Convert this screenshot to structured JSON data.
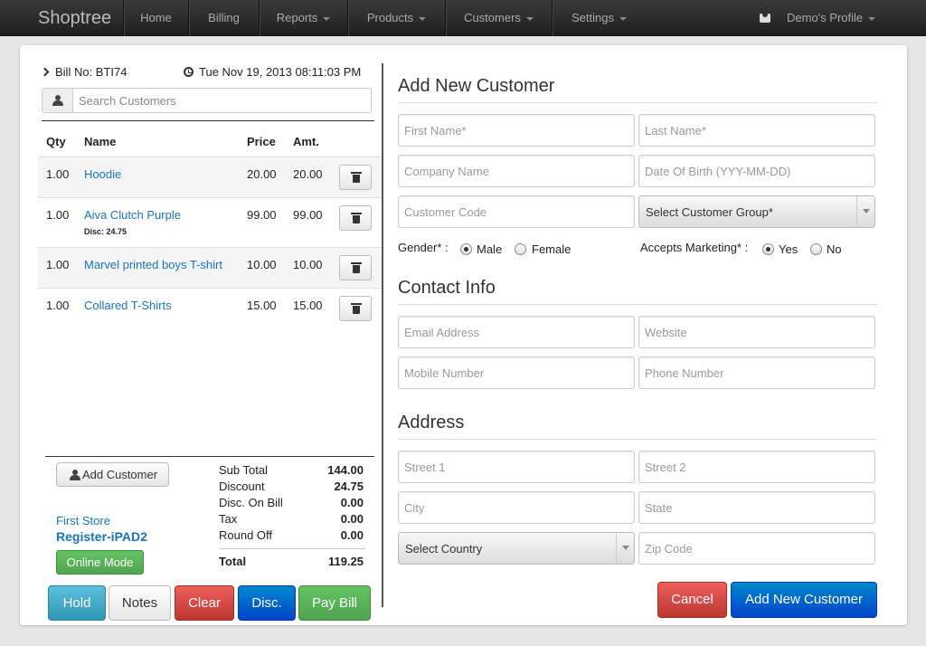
{
  "nav": {
    "brand": "Shoptree",
    "items": [
      "Home",
      "Billing",
      "Reports",
      "Products",
      "Customers",
      "Settings"
    ],
    "profile": "Demo's Profile"
  },
  "bill": {
    "bill_no": "Bill No: BTI74",
    "date": "Tue Nov 19, 2013 08:11:03 PM",
    "search_placeholder": "Search Customers",
    "headers": {
      "qty": "Qty",
      "name": "Name",
      "price": "Price",
      "amt": "Amt."
    },
    "items": [
      {
        "qty": "1.00",
        "name": "Hoodie",
        "price": "20.00",
        "amt": "20.00",
        "disc": ""
      },
      {
        "qty": "1.00",
        "name": "Aiva Clutch Purple",
        "price": "99.00",
        "amt": "99.00",
        "disc": "Disc: 24.75"
      },
      {
        "qty": "1.00",
        "name": "Marvel printed boys T-shirt",
        "price": "10.00",
        "amt": "10.00",
        "disc": ""
      },
      {
        "qty": "1.00",
        "name": "Collared T-Shirts",
        "price": "15.00",
        "amt": "15.00",
        "disc": ""
      }
    ],
    "add_customer": "Add Customer",
    "store": "First Store",
    "register": "Register-iPAD2",
    "online_mode": "Online Mode",
    "summary": [
      {
        "label": "Sub Total",
        "value": "144.00"
      },
      {
        "label": "Discount",
        "value": "24.75"
      },
      {
        "label": "Disc. On Bill",
        "value": "0.00"
      },
      {
        "label": "Tax",
        "value": "0.00"
      },
      {
        "label": "Round Off",
        "value": "0.00"
      }
    ],
    "total_label": "Total",
    "total_value": "119.25",
    "actions": {
      "hold": "Hold",
      "notes": "Notes",
      "clear": "Clear",
      "disc": "Disc.",
      "pay": "Pay Bill"
    }
  },
  "form": {
    "title": "Add New Customer",
    "first_name": "First Name*",
    "last_name": "Last Name*",
    "company": "Company Name",
    "dob": "Date Of Birth (YYY-MM-DD)",
    "customer_code": "Customer Code",
    "customer_group": "Select Customer Group*",
    "gender_label": "Gender* :",
    "gender_male": "Male",
    "gender_female": "Female",
    "marketing_label": "Accepts Marketing* :",
    "marketing_yes": "Yes",
    "marketing_no": "No",
    "contact_title": "Contact Info",
    "email": "Email Address",
    "website": "Website",
    "mobile": "Mobile Number",
    "phone": "Phone Number",
    "address_title": "Address",
    "street1": "Street 1",
    "street2": "Street 2",
    "city": "City",
    "state": "State",
    "country": "Select Country",
    "zip": "Zip Code",
    "cancel": "Cancel",
    "submit": "Add New Customer"
  }
}
